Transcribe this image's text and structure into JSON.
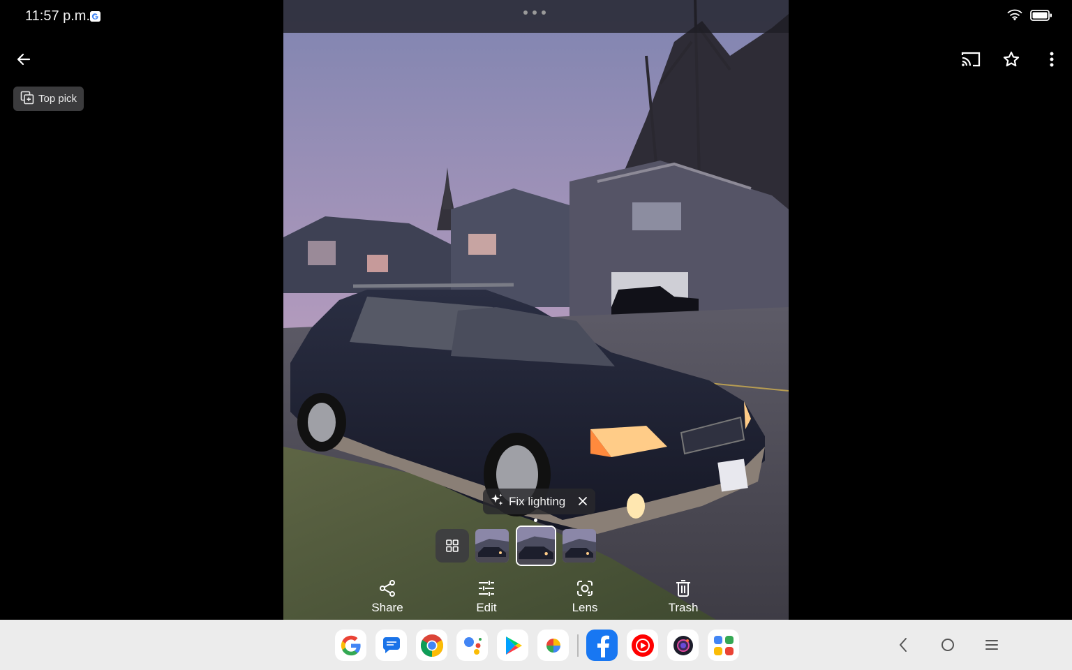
{
  "status_bar": {
    "time": "11:57 p.m.",
    "icons": [
      "google-badge-icon",
      "wifi-icon",
      "battery-icon"
    ]
  },
  "toolbar": {
    "back_icon": "arrow-left-icon",
    "cast_icon": "cast-icon",
    "favorite_icon": "star-outline-icon",
    "more_icon": "more-vertical-icon"
  },
  "top_pick": {
    "label": "Top pick",
    "icon": "burst-stack-icon"
  },
  "suggestion": {
    "label": "Fix lighting",
    "icon": "sparkle-icon",
    "close_icon": "close-icon"
  },
  "filmstrip": {
    "grid_icon": "grid-icon",
    "thumbnails": 3,
    "selected_index": 2
  },
  "actions": [
    {
      "label": "Share",
      "icon": "share-icon"
    },
    {
      "label": "Edit",
      "icon": "tune-sliders-icon"
    },
    {
      "label": "Lens",
      "icon": "lens-icon"
    },
    {
      "label": "Trash",
      "icon": "trash-icon"
    }
  ],
  "dock": {
    "apps": [
      "google-app-icon",
      "messages-app-icon",
      "chrome-app-icon",
      "assistant-app-icon",
      "play-store-app-icon",
      "photos-app-icon",
      "facebook-app-icon",
      "youtube-music-app-icon",
      "camera-app-icon",
      "app-drawer-icon"
    ]
  },
  "nav": {
    "icons": [
      "back-chevron-icon",
      "home-circle-icon",
      "recents-menu-icon"
    ]
  },
  "colors": {
    "background": "#000000",
    "chip_bg": "#3b3b3d",
    "taskbar_bg": "#ececec",
    "sky_top": "#7f84b0",
    "sky_bottom": "#b59ab8"
  }
}
